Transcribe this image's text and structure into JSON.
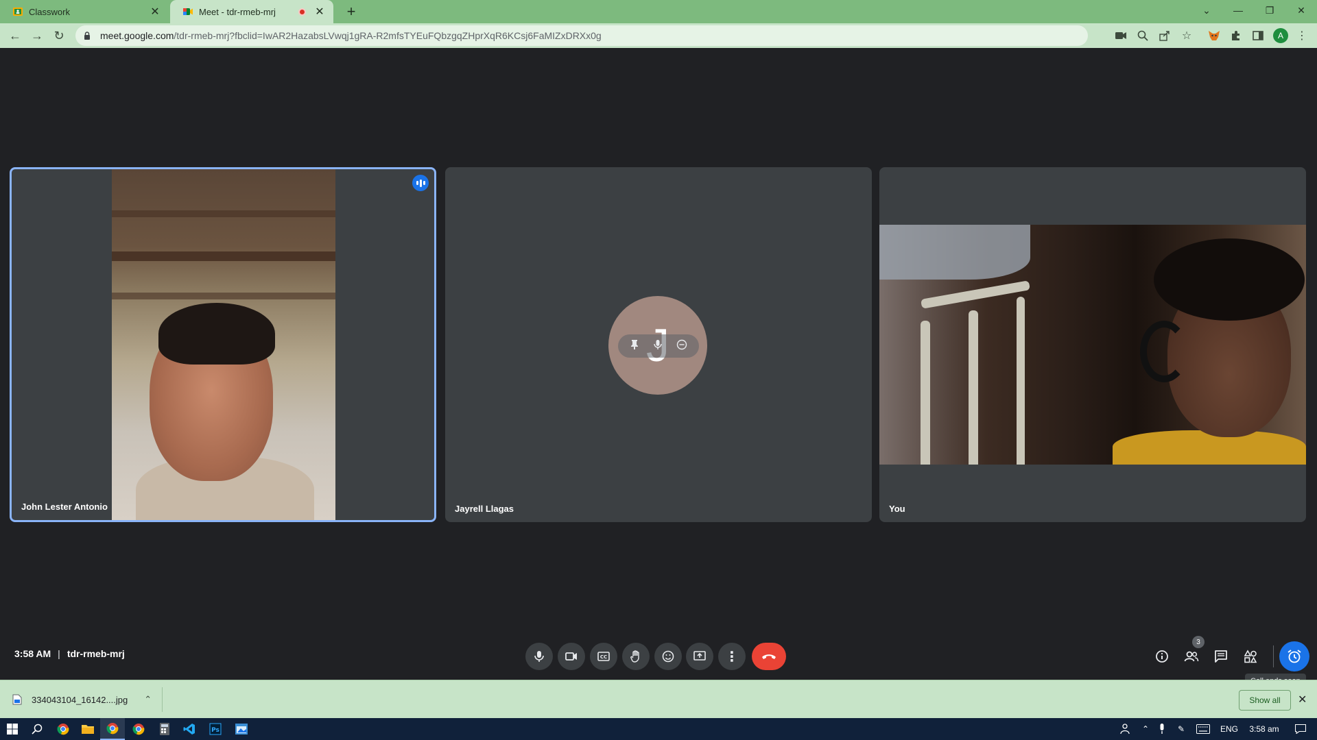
{
  "browser": {
    "tabs": [
      {
        "title": "Classwork",
        "active": false
      },
      {
        "title": "Meet - tdr-rmeb-mrj",
        "active": true
      }
    ],
    "new_tab": "+",
    "url_host": "meet.google.com",
    "url_path": "/tdr-rmeb-mrj?fbclid=IwAR2HazabsLVwqj1gRA-R2mfsTYEuFQbzgqZHprXqR6KCsj6FaMIZxDRXx0g",
    "profile_initial": "A"
  },
  "meet": {
    "participants": [
      {
        "name": "John Lester Antonio",
        "speaking": true,
        "video": true
      },
      {
        "name": "Jayrell Llagas",
        "avatar_initial": "J",
        "video": false
      },
      {
        "name": "You",
        "video": true
      }
    ],
    "time": "3:58 AM",
    "separator": "|",
    "meeting_code": "tdr-rmeb-mrj",
    "people_count": "3",
    "tooltip": "Call ends soon"
  },
  "downloads": {
    "file_name": "334043104_16142....jpg",
    "show_all": "Show all"
  },
  "taskbar": {
    "language": "ENG",
    "clock": "3:58 am"
  },
  "colors": {
    "tab_bar": "#7dba7e",
    "toolbar": "#c7e4c8",
    "meet_bg": "#202124",
    "tile_bg": "#3c4043",
    "accent_blue": "#1a73e8",
    "leave_red": "#ea4335",
    "avatar": "#a1887f"
  }
}
